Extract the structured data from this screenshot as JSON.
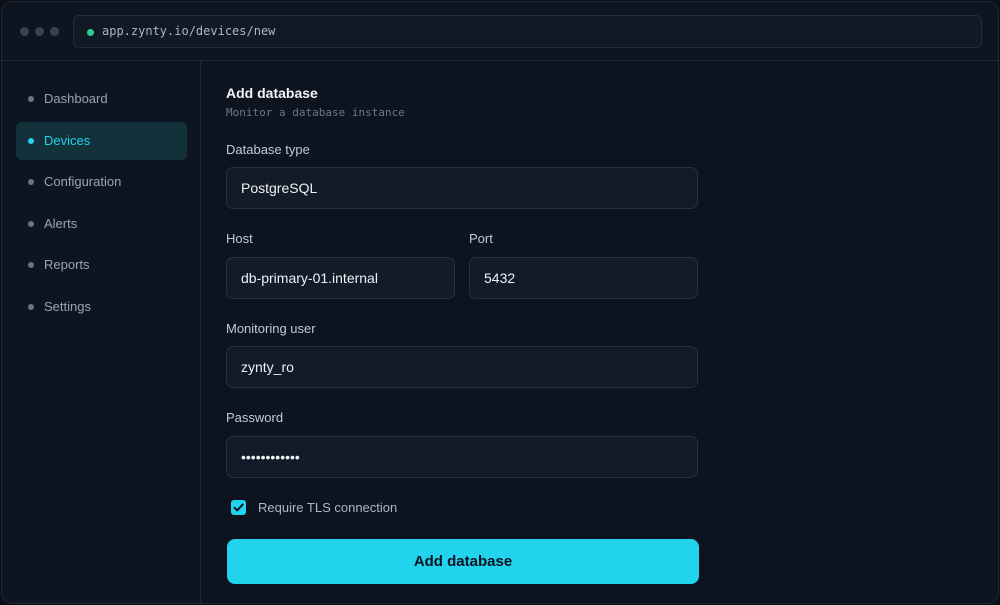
{
  "browser": {
    "url": "app.zynty.io/devices/new",
    "status_color": "#2ecc8f"
  },
  "sidebar": {
    "items": [
      {
        "label": "Dashboard",
        "active": false
      },
      {
        "label": "Devices",
        "active": true
      },
      {
        "label": "Configuration",
        "active": false
      },
      {
        "label": "Alerts",
        "active": false
      },
      {
        "label": "Reports",
        "active": false
      },
      {
        "label": "Settings",
        "active": false
      }
    ]
  },
  "form": {
    "title": "Add database",
    "subtitle": "Monitor a database instance",
    "database_type": {
      "label": "Database type",
      "value": "PostgreSQL"
    },
    "host": {
      "label": "Host",
      "value": "db-primary-01.internal"
    },
    "port": {
      "label": "Port",
      "value": "5432"
    },
    "monitoring_user": {
      "label": "Monitoring user",
      "value": "zynty_ro"
    },
    "password": {
      "label": "Password",
      "value": "••••••••••••"
    },
    "tls": {
      "label": "Require TLS connection",
      "checked": true
    },
    "submit_label": "Add database"
  },
  "colors": {
    "accent": "#22d3ee",
    "background": "#0d131f",
    "sidebar_active": "#12313a"
  }
}
